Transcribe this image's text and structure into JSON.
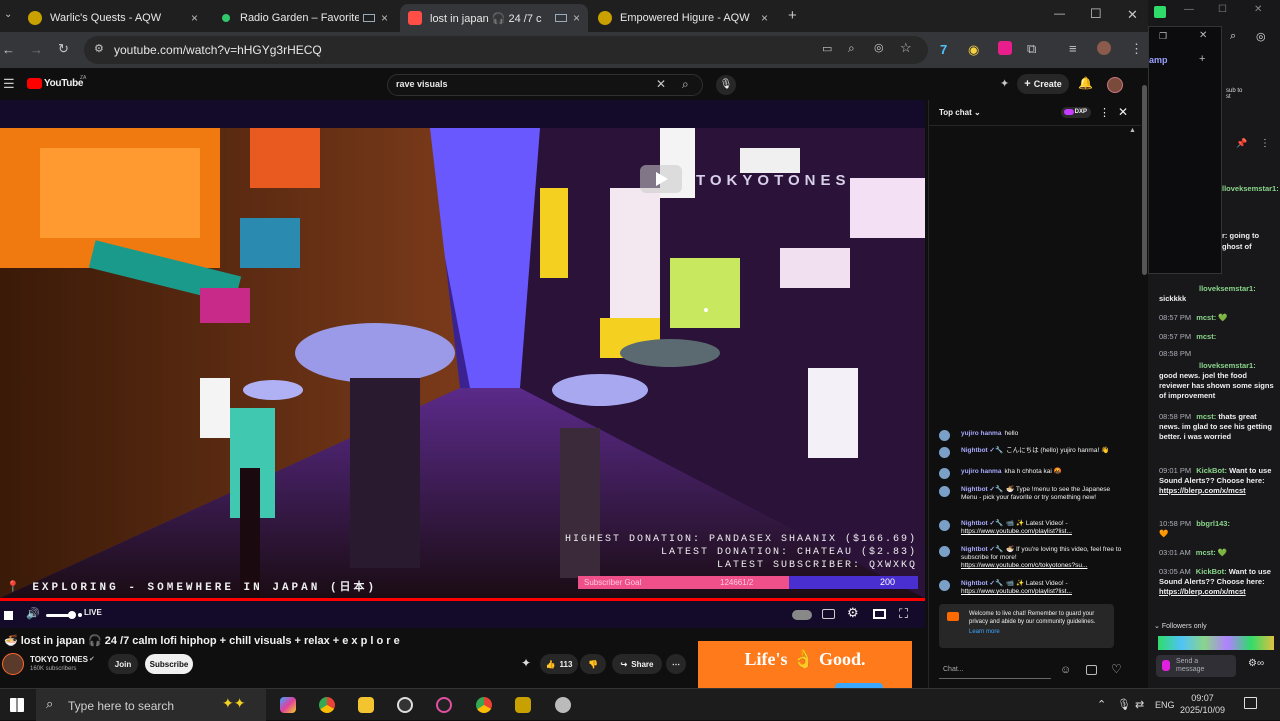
{
  "browser": {
    "tabs": [
      {
        "title": "Warlic's Quests - AQW",
        "close": "×",
        "favicon_color": "#c8a000"
      },
      {
        "title": "Radio Garden – Favorites",
        "close": "×",
        "favicon_color": "#2fc86a"
      },
      {
        "title": "lost in japan 🎧 24 /7 c",
        "close": "×",
        "favicon_color": "#ff4e45"
      },
      {
        "title": "Empowered Higure - AQW",
        "close": "×",
        "favicon_color": "#c8a000"
      }
    ],
    "new_tab": "+",
    "url": "youtube.com/watch?v=hHGYg3rHECQ",
    "window_controls": {
      "minimize": "—",
      "maximize": "☐",
      "close": "✕"
    }
  },
  "youtube": {
    "logo_text": "YouTube",
    "logo_region": "ZA",
    "search_value": "rave visuals",
    "create_label": "Create",
    "video": {
      "watermark": "TOKYOTONES",
      "overlay_lines": [
        "HIGHEST DONATION: PANDASEX SHAANIX  ($166.69)",
        "LATEST DONATION: CHATEAU ($2.83)",
        "LATEST SUBSCRIBER: QXWXKQ"
      ],
      "subscriber_goal_label": "Subscriber Goal",
      "subscriber_goal_count": "124661/2",
      "goal_right": "200",
      "goal_fraction": 0.62,
      "location_caption": "EXPLORING - SOMEWHERE IN JAPAN (日本)",
      "live_label": "LIVE"
    },
    "title": "🍜 lost in japan 🎧 24 /7 calm lofi hiphop + chill visuals + relax + e x p l o r e",
    "channel": {
      "name": "TOKYO TONES",
      "subscribers": "160K subscribers"
    },
    "join_label": "Join",
    "subscribe_label": "Subscribe",
    "like_count": "113",
    "share_label": "Share",
    "ad_text": "Life's 👌 Good.",
    "chat": {
      "header": "Top chat",
      "badge": "DXP",
      "messages": [
        {
          "author": "yujiro hanma",
          "text": "hello"
        },
        {
          "author": "Nightbot ✓🔧",
          "text": "こんにちは (hello) yujiro hanma! 👋"
        },
        {
          "author": "yujiro hanma",
          "text": "kha h chhota kai 🤬"
        },
        {
          "author": "Nightbot ✓🔧",
          "text": "🍜 Type !menu to see the Japanese Menu - pick your favorite or try something new!"
        },
        {
          "author": "Nightbot ✓🔧",
          "text": "📹 ✨ Latest Video! - ",
          "link": "https://www.youtube.com/playlist?list..."
        },
        {
          "author": "Nightbot ✓🔧",
          "text": "🍜 If you're loving this video, feel free to subscribe for more! ",
          "link": "https://www.youtube.com/c/tokyotones?su..."
        },
        {
          "author": "Nightbot ✓🔧",
          "text": "📹 ✨ Latest Video! - ",
          "link": "https://www.youtube.com/playlist?list..."
        }
      ],
      "notice": "Welcome to live chat! Remember to guard your privacy and abide by our community guidelines.",
      "notice_link": "Learn more",
      "input_placeholder": "Chat..."
    }
  },
  "twitch": {
    "partial_title": "amp",
    "partial_sub": "sub to\nst",
    "messages": [
      {
        "time": "",
        "user": "lloveksemstar1:",
        "text": "sickkkk"
      },
      {
        "time": "08:57 PM",
        "user": "mcst:",
        "text": "💚"
      },
      {
        "time": "08:57 PM",
        "user": "mcst:",
        "text": ""
      },
      {
        "time": "08:58 PM",
        "user": "",
        "text": ""
      },
      {
        "time": "",
        "user": "lloveksemstar1:",
        "text": "good news. joel the food reviewer has shown some signs of improvement"
      },
      {
        "time": "08:58 PM",
        "user": "mcst:",
        "text": "thats great news. im glad to see his getting better. i was worried"
      },
      {
        "time": "09:01 PM",
        "user": "KickBot:",
        "text": "Want to use Sound Alerts?? Choose here:"
      },
      {
        "time": "10:58 PM",
        "user": "bbgrl143:",
        "text": "🧡"
      },
      {
        "time": "03:01 AM",
        "user": "mcst:",
        "text": "💚"
      },
      {
        "time": "03:05 AM",
        "user": "KickBot:",
        "text": "Want to use Sound Alerts?? Choose here:"
      }
    ],
    "links": [
      "https://blerp.com/x/mcst",
      "https://blerp.com/x/mcst"
    ],
    "partial_lines": [
      "lloveksemstar1:",
      "r: going to",
      "ghost of"
    ],
    "followers_only": "Followers only",
    "send_placeholder": "Send a message"
  },
  "taskbar": {
    "search_placeholder": "Type here to search",
    "language": "ENG",
    "time": "09:07",
    "date": "2025/10/09"
  }
}
